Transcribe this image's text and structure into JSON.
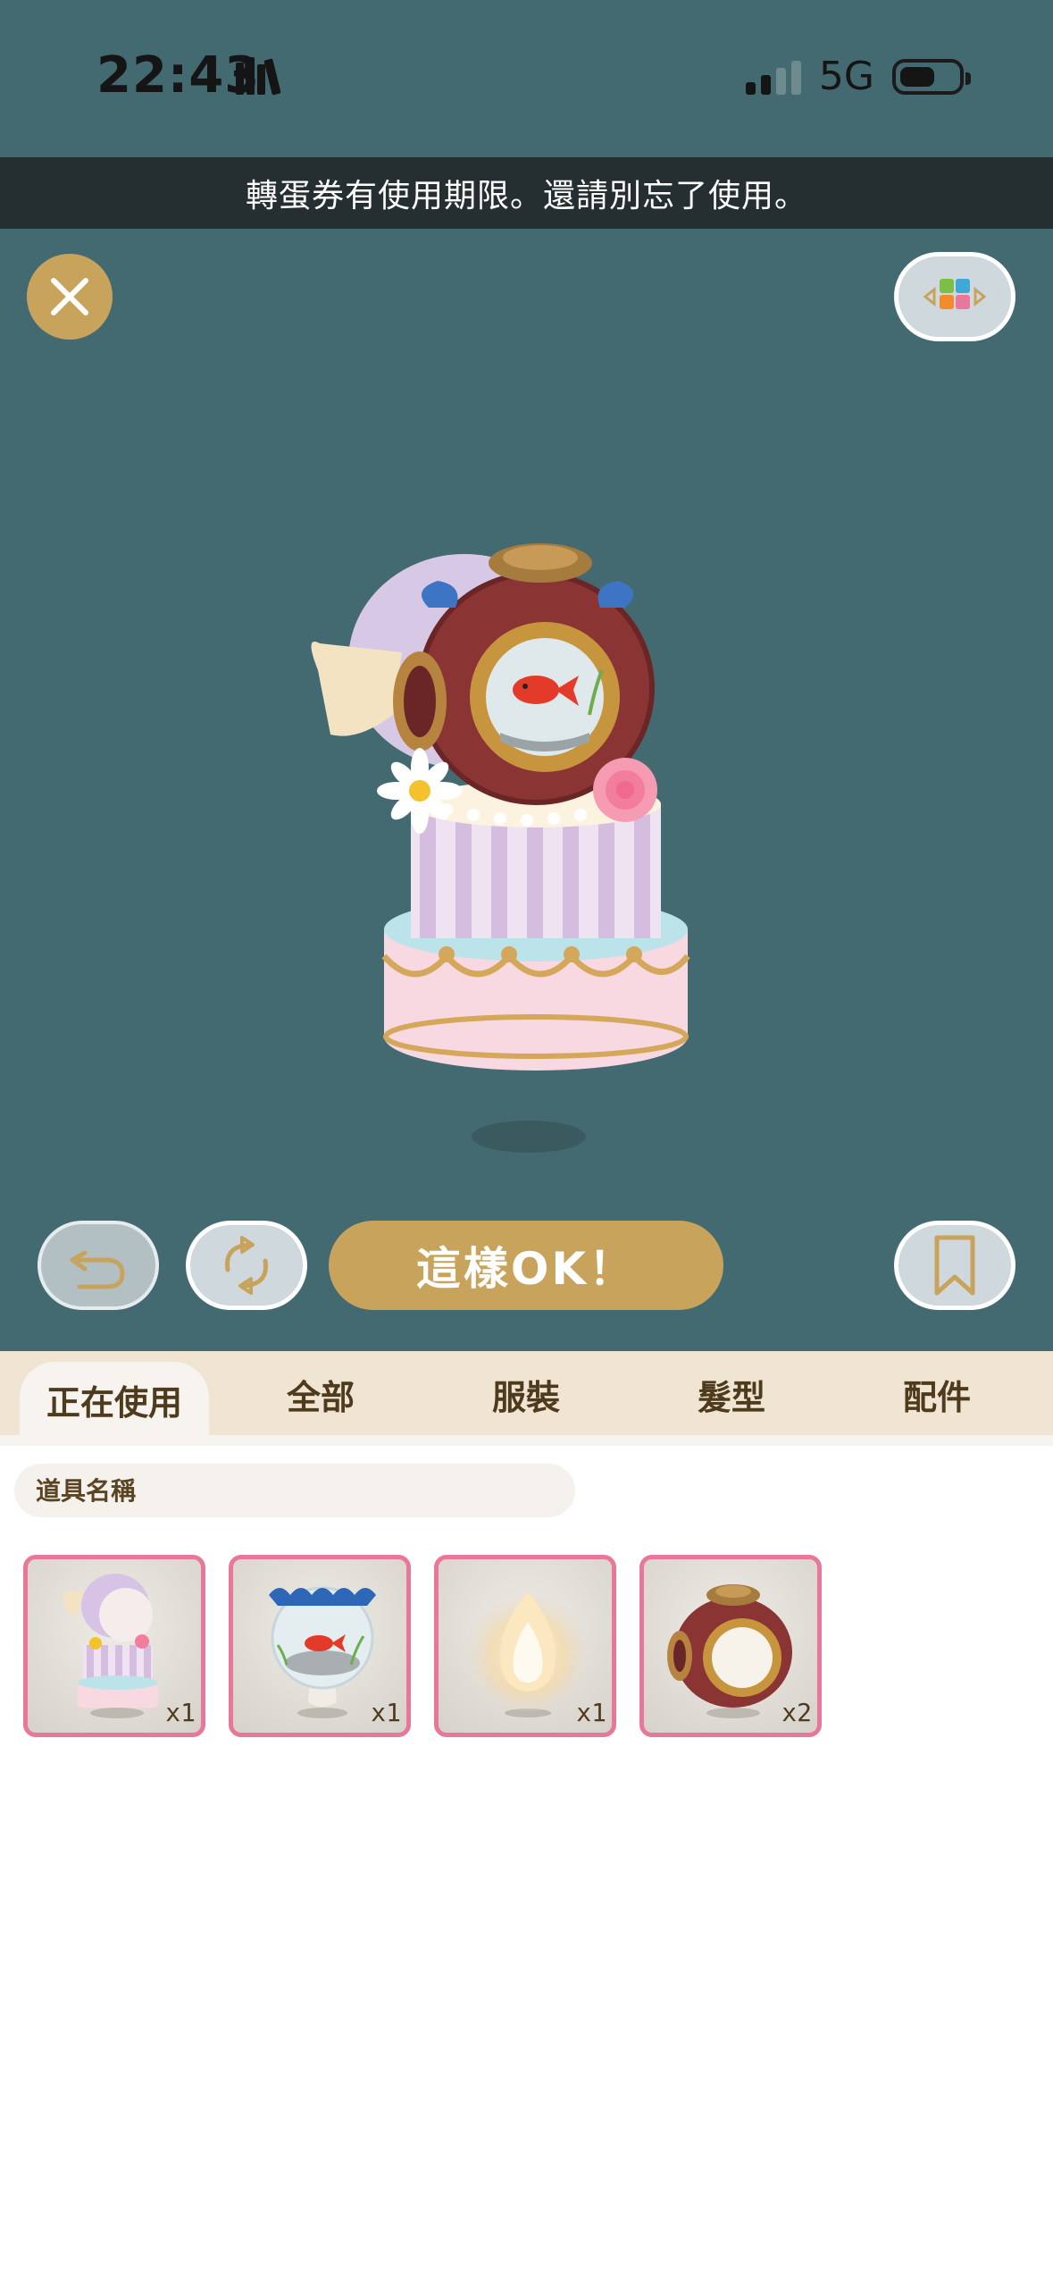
{
  "status_bar": {
    "time": "22:43",
    "network": "5G"
  },
  "notice": "轉蛋券有使用期限。還請別忘了使用。",
  "controls": {
    "ok_label": "這樣OK！"
  },
  "tabs": [
    {
      "label": "正在使用",
      "active": true
    },
    {
      "label": "全部",
      "active": false
    },
    {
      "label": "服裝",
      "active": false
    },
    {
      "label": "髮型",
      "active": false
    },
    {
      "label": "配件",
      "active": false
    }
  ],
  "search": {
    "placeholder": "道具名稱"
  },
  "items": [
    {
      "icon": "cake-dress-icon",
      "qty": "x1"
    },
    {
      "icon": "goldfish-bowl-icon",
      "qty": "x1"
    },
    {
      "icon": "glow-flame-icon",
      "qty": "x1"
    },
    {
      "icon": "diving-helmet-icon",
      "qty": "x2"
    }
  ],
  "colors": {
    "stage": "#446a71",
    "gold": "#c8a35c",
    "tab_bar": "#f0e5d3",
    "item_border": "#e8779a"
  }
}
